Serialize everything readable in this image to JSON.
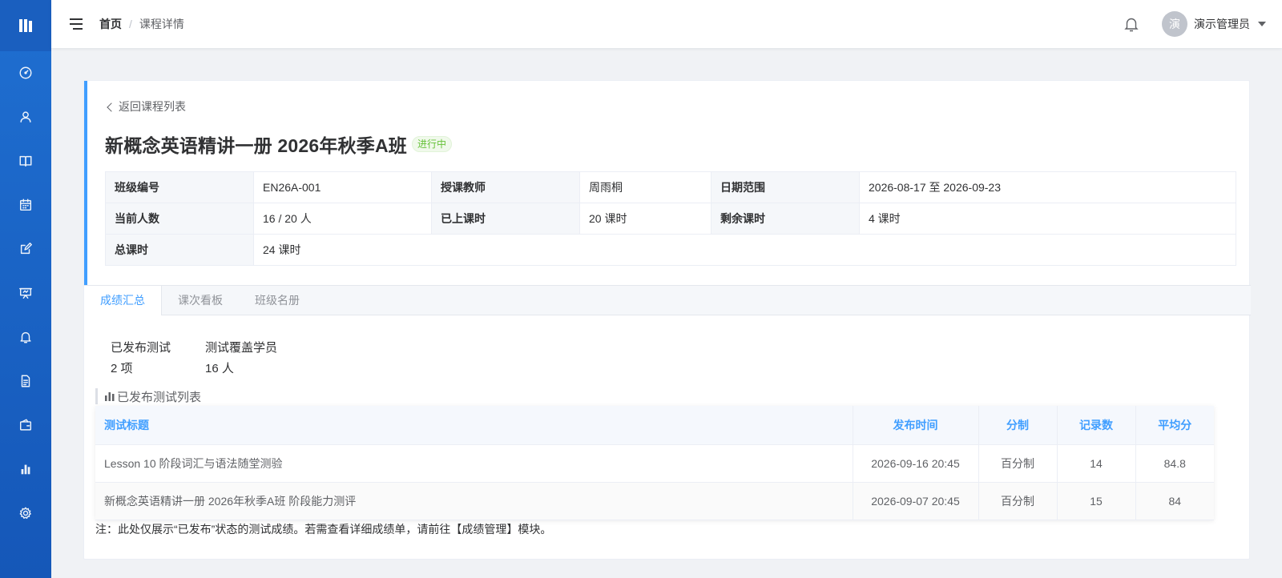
{
  "sidebar": {
    "logo_icon": "app-logo-icon",
    "items": [
      {
        "name": "dashboard",
        "icon": "dashboard-icon"
      },
      {
        "name": "users",
        "icon": "user-icon"
      },
      {
        "name": "courses",
        "icon": "book-icon"
      },
      {
        "name": "schedule",
        "icon": "calendar-icon"
      },
      {
        "name": "homework",
        "icon": "edit-icon"
      },
      {
        "name": "classroom",
        "icon": "presentation-icon"
      },
      {
        "name": "notifications",
        "icon": "bell-icon"
      },
      {
        "name": "documents",
        "icon": "document-icon"
      },
      {
        "name": "wallet",
        "icon": "wallet-icon"
      },
      {
        "name": "statistics",
        "icon": "bar-chart-icon"
      },
      {
        "name": "settings",
        "icon": "gear-icon"
      }
    ]
  },
  "header": {
    "breadcrumb": {
      "home": "首页",
      "separator": "/",
      "current": "课程详情"
    },
    "user": {
      "avatar_text": "演",
      "name": "演示管理员"
    }
  },
  "course": {
    "back_label": "返回课程列表",
    "title": "新概念英语精讲一册 2026年秋季A班",
    "status": "进行中",
    "info": {
      "class_code_label": "班级编号",
      "class_code": "EN26A-001",
      "teacher_label": "授课教师",
      "teacher": "周雨桐",
      "date_range_label": "日期范围",
      "date_range": "2026-08-17 至 2026-09-23",
      "current_students_label": "当前人数",
      "current_students": "16 / 20 人",
      "taught_hours_label": "已上课时",
      "taught_hours": "20 课时",
      "remaining_hours_label": "剩余课时",
      "remaining_hours": "4 课时",
      "total_hours_label": "总课时",
      "total_hours": "24 课时"
    }
  },
  "tabs": [
    "成绩汇总",
    "课次看板",
    "班级名册"
  ],
  "stats": {
    "published_label": "已发布测试",
    "published_value": "2 项",
    "covered_label": "测试覆盖学员",
    "covered_value": "16 人"
  },
  "section_title": "已发布测试列表",
  "test_table": {
    "headers": [
      "测试标题",
      "发布时间",
      "分制",
      "记录数",
      "平均分"
    ],
    "rows": [
      [
        "Lesson 10 阶段词汇与语法随堂测验",
        "2026-09-16 20:45",
        "百分制",
        "14",
        "84.8"
      ],
      [
        "新概念英语精讲一册 2026年秋季A班 阶段能力测评",
        "2026-09-07 20:45",
        "百分制",
        "15",
        "84"
      ]
    ]
  },
  "note": "注：此处仅展示“已发布”状态的测试成绩。若需查看详细成绩单，请前往【成绩管理】模块。",
  "colors": {
    "primary": "#409eff",
    "sidebar": "#1f6fd1",
    "success": "#67c23a"
  }
}
